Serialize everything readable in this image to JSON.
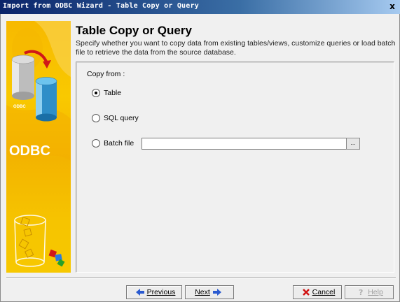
{
  "window": {
    "title": "Import from ODBC Wizard - Table Copy or Query",
    "close_glyph": "x"
  },
  "banner": {
    "logo_text": "ODBC",
    "small_label": "ODBC"
  },
  "header": {
    "title": "Table Copy or Query",
    "description": "Specify whether you want to copy data from existing tables/views, customize queries or load batch file to retrieve the data from the source database."
  },
  "form": {
    "group_label": "Copy from :",
    "options": [
      {
        "label": "Table",
        "checked": true
      },
      {
        "label": "SQL query",
        "checked": false
      },
      {
        "label": "Batch file",
        "checked": false
      }
    ],
    "batch_file_value": "",
    "browse_label": "..."
  },
  "buttons": {
    "previous": "Previous",
    "next": "Next",
    "cancel": "Cancel",
    "help": "Help"
  },
  "icons": {
    "previous": "arrow-left-icon",
    "next": "arrow-right-icon",
    "cancel": "red-x-icon",
    "help": "question-mark-icon"
  },
  "colors": {
    "banner": "#f7c000",
    "titlebar": "#0a246a",
    "arrow_blue": "#2a5ad0",
    "cancel_red": "#d01010"
  }
}
